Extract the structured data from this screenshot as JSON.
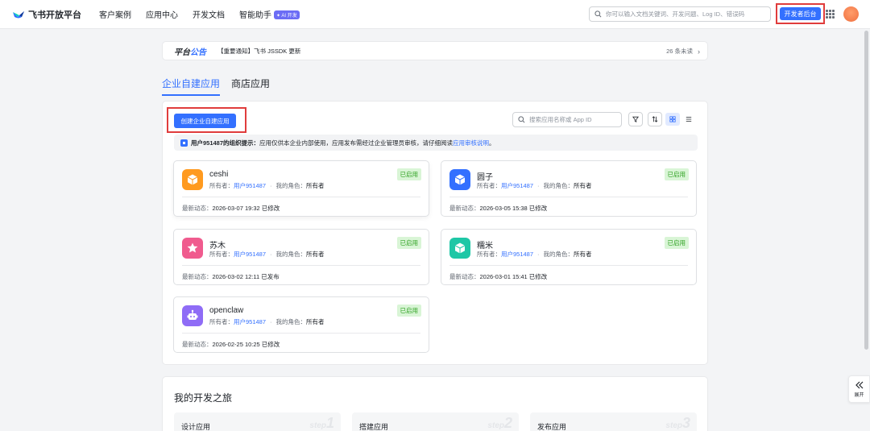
{
  "topnav": {
    "logo_text": "飞书开放平台",
    "items": [
      "客户案例",
      "应用中心",
      "开发文档",
      "智能助手"
    ],
    "ai_badge": "✦ AI 开发",
    "search_placeholder": "你可以输入文档关键词、开发问题、Log ID、错误码",
    "dev_console_label": "开发者后台"
  },
  "announcement": {
    "label_a": "平台",
    "label_b": "公告",
    "text": "【重要通知】飞书 JSSDK 更新",
    "unread": "26 条未读"
  },
  "tabs": [
    {
      "label": "企业自建应用",
      "active": true
    },
    {
      "label": "商店应用",
      "active": false
    }
  ],
  "panel": {
    "create_label": "创建企业自建应用",
    "search_placeholder": "搜索应用名称或 App ID",
    "notice_bold": "用户951487的组织提示：",
    "notice_text": "应用仅供本企业内部使用，应用发布需经过企业管理员审核，请仔细阅读",
    "notice_link": "应用审核说明",
    "notice_end": "。"
  },
  "card_labels": {
    "owner": "所有者：",
    "role": "我的角色：",
    "activity": "最新动态："
  },
  "apps": [
    {
      "name": "ceshi",
      "status": "已启用",
      "owner": "用户951487",
      "role": "所有者",
      "activity": "2026-03-07 19:32 已修改",
      "icon": "box-icon",
      "color": "#ff9a1f"
    },
    {
      "name": "圆子",
      "status": "已启用",
      "owner": "用户951487",
      "role": "所有者",
      "activity": "2026-03-05 15:38 已修改",
      "icon": "box-icon",
      "color": "#3370ff"
    },
    {
      "name": "苏木",
      "status": "已启用",
      "owner": "用户951487",
      "role": "所有者",
      "activity": "2026-03-02 12:11 已发布",
      "icon": "star-icon",
      "color": "#f05b8e"
    },
    {
      "name": "糯米",
      "status": "已启用",
      "owner": "用户951487",
      "role": "所有者",
      "activity": "2026-03-01 15:41 已修改",
      "icon": "box-icon",
      "color": "#1ec7a6"
    },
    {
      "name": "openclaw",
      "status": "已启用",
      "owner": "用户951487",
      "role": "所有者",
      "activity": "2026-02-25 10:25 已修改",
      "icon": "robot-icon",
      "color": "#8f6cf6"
    }
  ],
  "journey": {
    "title": "我的开发之旅",
    "steps": [
      {
        "label": "设计应用",
        "bg": "step",
        "num": "1"
      },
      {
        "label": "搭建应用",
        "bg": "step",
        "num": "2"
      },
      {
        "label": "发布应用",
        "bg": "step",
        "num": "3"
      }
    ]
  },
  "expand_label": "展开"
}
